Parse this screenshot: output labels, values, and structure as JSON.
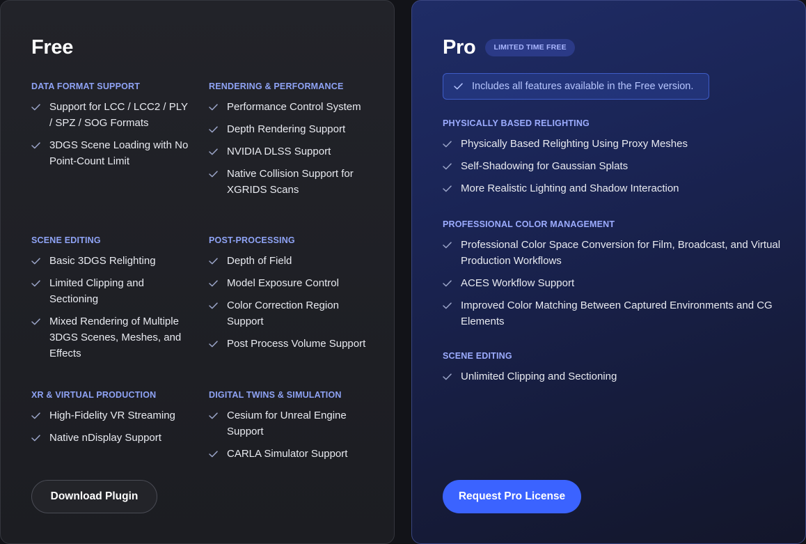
{
  "free": {
    "title": "Free",
    "button_label": "Download Plugin",
    "col_left": [
      {
        "title": "DATA FORMAT SUPPORT",
        "items": [
          "Support for LCC / LCC2 / PLY / SPZ / SOG Formats",
          "3DGS Scene Loading with No Point-Count Limit"
        ]
      },
      {
        "title": "SCENE EDITING",
        "items": [
          "Basic 3DGS Relighting",
          "Limited Clipping and Sectioning",
          "Mixed Rendering of Multiple 3DGS Scenes, Meshes, and Effects"
        ]
      },
      {
        "title": "XR & VIRTUAL PRODUCTION",
        "items": [
          "High-Fidelity VR Streaming",
          "Native nDisplay Support"
        ]
      }
    ],
    "col_right": [
      {
        "title": "RENDERING & PERFORMANCE",
        "items": [
          "Performance Control System",
          "Depth Rendering Support",
          "NVIDIA DLSS Support",
          "Native Collision Support for XGRIDS Scans"
        ]
      },
      {
        "title": "POST-PROCESSING",
        "items": [
          "Depth of Field",
          "Model Exposure Control",
          "Color Correction Region Support",
          "Post Process Volume Support"
        ]
      },
      {
        "title": "DIGITAL TWINS & SIMULATION",
        "items": [
          "Cesium for Unreal Engine Support",
          "CARLA Simulator Support"
        ]
      }
    ]
  },
  "pro": {
    "title": "Pro",
    "badge": "LIMITED TIME FREE",
    "info": "Includes all features available in the Free version.",
    "button_label": "Request Pro License",
    "sections": [
      {
        "title": "PHYSICALLY BASED RELIGHTING",
        "items": [
          "Physically Based Relighting Using Proxy Meshes",
          "Self-Shadowing for Gaussian Splats",
          "More Realistic Lighting and Shadow Interaction"
        ]
      },
      {
        "title": "PROFESSIONAL COLOR MANAGEMENT",
        "items": [
          "Professional Color Space Conversion for Film, Broadcast, and Virtual Production Workflows",
          "ACES Workflow Support",
          "Improved Color Matching Between Captured Environments and CG Elements"
        ]
      },
      {
        "title": "SCENE EDITING",
        "items": [
          "Unlimited Clipping and Sectioning"
        ]
      }
    ]
  },
  "icons": {
    "check": "check-icon"
  },
  "colors": {
    "accent": "#3b63ff",
    "section_title": "#8fa3f5",
    "check": "#9aa4c8"
  }
}
